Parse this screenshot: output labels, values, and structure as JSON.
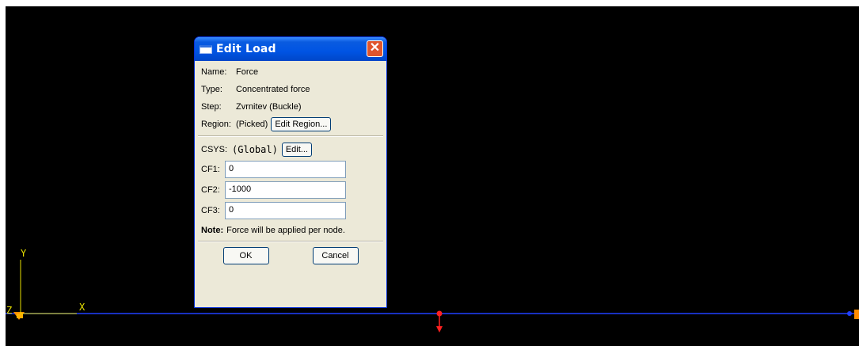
{
  "dialog": {
    "title": "Edit Load",
    "close_symbol": "✕",
    "name_label": "Name:",
    "name_value": "Force",
    "type_label": "Type:",
    "type_value": "Concentrated force",
    "step_label": "Step:",
    "step_value": "Zvrnitev (Buckle)",
    "region_label": "Region:",
    "region_value": "(Picked)",
    "edit_region_button": "Edit Region...",
    "csys_label": "CSYS:",
    "csys_value": "(Global)",
    "edit_button": "Edit...",
    "fields": [
      {
        "label": "CF1:",
        "value": "0"
      },
      {
        "label": "CF2:",
        "value": "-1000"
      },
      {
        "label": "CF3:",
        "value": "0"
      }
    ],
    "note_label": "Note:",
    "note_text": "Force will be applied per node.",
    "ok_button": "OK",
    "cancel_button": "Cancel"
  },
  "viewport": {
    "axis_labels": {
      "x": "X",
      "y": "Y",
      "z": "Z"
    },
    "colors": {
      "background": "#000000",
      "beam": "#2040ff",
      "axis": "#e8e000",
      "load": "#ff2020",
      "support": "#ff8c00"
    }
  }
}
